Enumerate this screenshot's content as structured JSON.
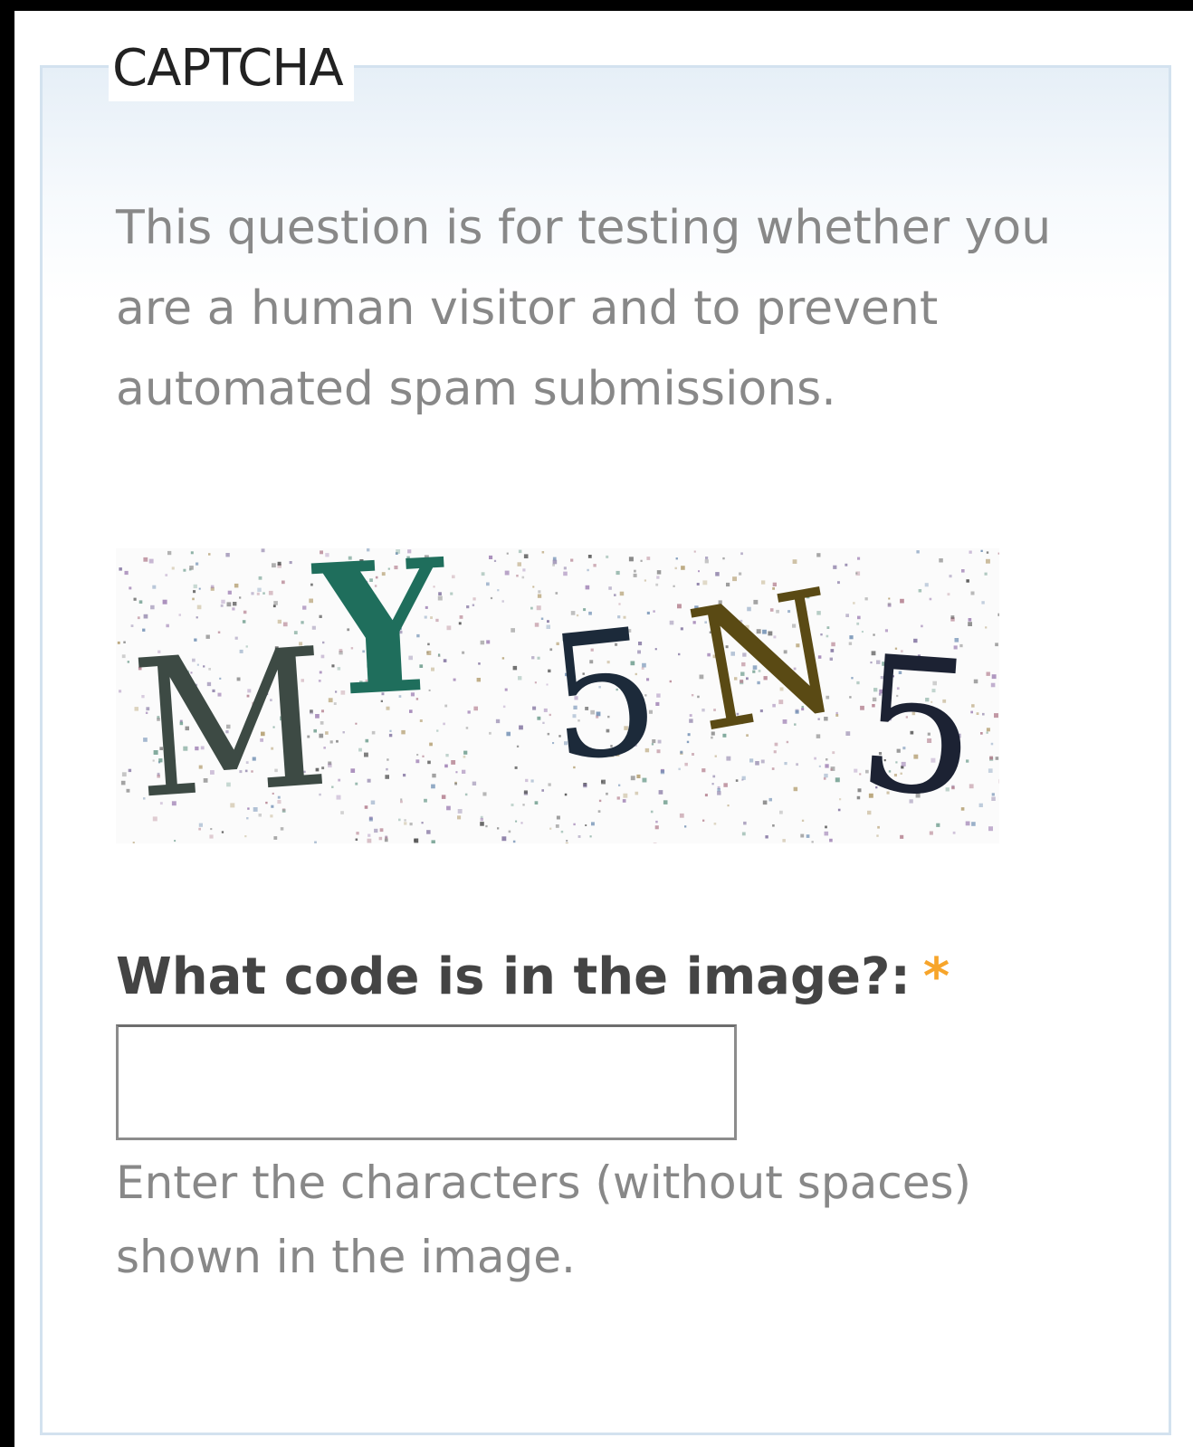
{
  "captcha": {
    "legend": "CAPTCHA",
    "description": "This question is for testing whether you are a human visitor and to prevent automated spam submissions.",
    "image": {
      "characters": [
        "M",
        "Y",
        "5",
        "N",
        "5"
      ],
      "colors": [
        "#3d4a44",
        "#1f6e5c",
        "#1c2a3a",
        "#5a4a14",
        "#1c2233"
      ]
    },
    "question_label": "What code is in the image?:",
    "required_marker": "*",
    "input": {
      "value": "",
      "placeholder": ""
    },
    "hint": "Enter the characters (without spaces) shown in the image."
  },
  "colors": {
    "border": "#d3e2ef",
    "required": "#f7a52b",
    "muted_text": "#888888"
  }
}
